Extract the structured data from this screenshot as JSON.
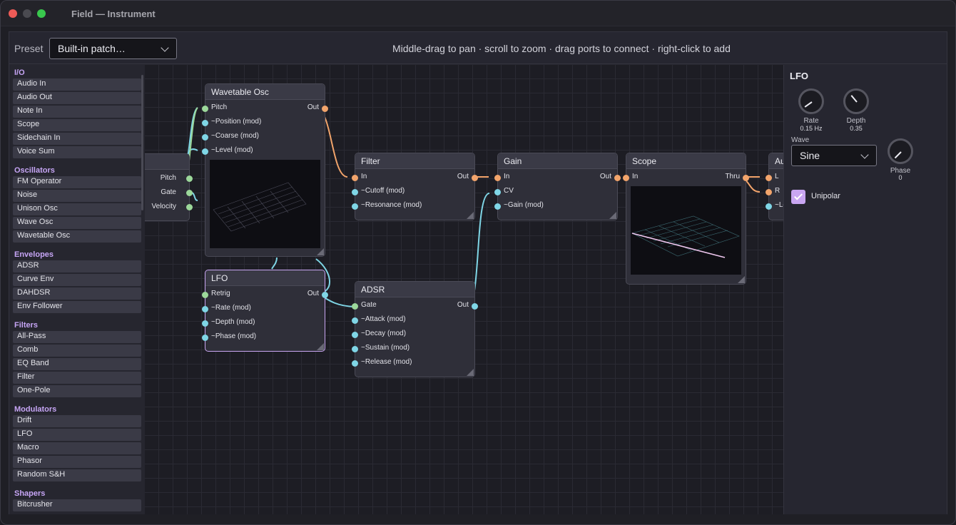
{
  "window": {
    "title": "Field — Instrument"
  },
  "toolbar": {
    "preset_label": "Preset",
    "preset_value": "Built-in patch…",
    "hint": "Middle-drag to pan · scroll to zoom · drag ports to connect · right-click to add"
  },
  "sidebar": {
    "categories": [
      {
        "name": "I/O",
        "items": [
          "Audio In",
          "Audio Out",
          "Note In",
          "Scope",
          "Sidechain In",
          "Voice Sum"
        ]
      },
      {
        "name": "Oscillators",
        "items": [
          "FM Operator",
          "Noise",
          "Unison Osc",
          "Wave Osc",
          "Wavetable Osc"
        ]
      },
      {
        "name": "Envelopes",
        "items": [
          "ADSR",
          "Curve Env",
          "DAHDSR",
          "Env Follower"
        ]
      },
      {
        "name": "Filters",
        "items": [
          "All-Pass",
          "Comb",
          "EQ Band",
          "Filter",
          "One-Pole"
        ]
      },
      {
        "name": "Modulators",
        "items": [
          "Drift",
          "LFO",
          "Macro",
          "Phasor",
          "Random S&H"
        ]
      },
      {
        "name": "Shapers",
        "items": [
          "Bitcrusher"
        ]
      }
    ]
  },
  "nodes": {
    "note": {
      "ports": [
        "Pitch",
        "Gate",
        "Velocity"
      ]
    },
    "wavetable": {
      "title": "Wavetable Osc",
      "inputs": [
        "Pitch",
        "~Position (mod)",
        "~Coarse (mod)",
        "~Level (mod)"
      ],
      "output": "Out"
    },
    "filter": {
      "title": "Filter",
      "inputs": [
        "In",
        "~Cutoff (mod)",
        "~Resonance (mod)"
      ],
      "output": "Out"
    },
    "gain": {
      "title": "Gain",
      "inputs": [
        "In",
        "CV",
        "~Gain (mod)"
      ],
      "output": "Out"
    },
    "scope": {
      "title": "Scope",
      "input": "In",
      "output": "Thru"
    },
    "audio": {
      "title": "Audi",
      "inputs": [
        "L",
        "R",
        "~Lev"
      ]
    },
    "lfo": {
      "title": "LFO",
      "inputs": [
        "Retrig",
        "~Rate (mod)",
        "~Depth (mod)",
        "~Phase (mod)"
      ],
      "output": "Out"
    },
    "adsr": {
      "title": "ADSR",
      "inputs": [
        "Gate",
        "~Attack (mod)",
        "~Decay (mod)",
        "~Sustain (mod)",
        "~Release (mod)"
      ],
      "output": "Out"
    }
  },
  "inspector": {
    "title": "LFO",
    "rate": {
      "label": "Rate",
      "value": "0.15 Hz"
    },
    "depth": {
      "label": "Depth",
      "value": "0.35"
    },
    "phase": {
      "label": "Phase",
      "value": "0"
    },
    "wave": {
      "label": "Wave",
      "value": "Sine"
    },
    "unipolar": {
      "label": "Unipolar",
      "checked": true
    }
  },
  "colors": {
    "accent": "#c9a6f2",
    "audio_port": "#f2a46b",
    "mod_port": "#7fd6e6",
    "gate_port": "#9cd89a"
  }
}
